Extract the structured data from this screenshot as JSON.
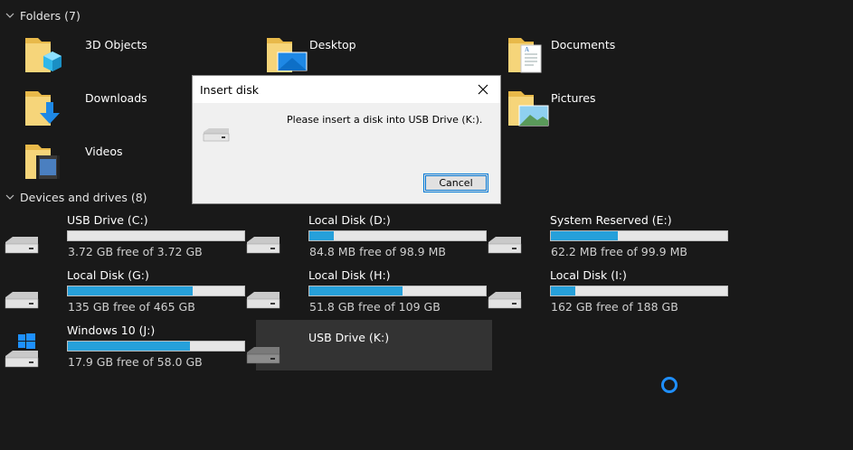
{
  "folders_section": {
    "label": "Folders (7)"
  },
  "folders": [
    {
      "name": "3D Objects",
      "icon": "folder-3d-objects-icon"
    },
    {
      "name": "Desktop",
      "icon": "folder-desktop-icon"
    },
    {
      "name": "Documents",
      "icon": "folder-documents-icon"
    },
    {
      "name": "Downloads",
      "icon": "folder-downloads-icon"
    },
    {
      "name": "Pictures",
      "icon": "folder-pictures-icon"
    },
    {
      "name": "Videos",
      "icon": "folder-videos-icon"
    }
  ],
  "drives_section": {
    "label": "Devices and drives (8)"
  },
  "drives": [
    {
      "name": "USB Drive (C:)",
      "free_text": "3.72 GB free of 3.72 GB",
      "used_fraction": 0.0
    },
    {
      "name": "Local Disk (D:)",
      "free_text": "84.8 MB free of 98.9 MB",
      "used_fraction": 0.14
    },
    {
      "name": "System Reserved (E:)",
      "free_text": "62.2 MB free of 99.9 MB",
      "used_fraction": 0.38
    },
    {
      "name": "Local Disk (G:)",
      "free_text": "135 GB free of 465 GB",
      "used_fraction": 0.71
    },
    {
      "name": "Local Disk (H:)",
      "free_text": "51.8 GB free of 109 GB",
      "used_fraction": 0.53
    },
    {
      "name": "Local Disk (I:)",
      "free_text": "162 GB free of 188 GB",
      "used_fraction": 0.14
    },
    {
      "name": "Windows 10 (J:)",
      "free_text": "17.9 GB free of 58.0 GB",
      "used_fraction": 0.69
    },
    {
      "name": "USB Drive (K:)",
      "free_text": "",
      "used_fraction": null
    }
  ],
  "dialog": {
    "title": "Insert disk",
    "message": "Please insert a disk into USB Drive (K:).",
    "cancel_label": "Cancel"
  },
  "colors": {
    "background": "#191919",
    "bar_fill": "#26a0da",
    "selection": "#333333",
    "accent": "#0078d7"
  }
}
